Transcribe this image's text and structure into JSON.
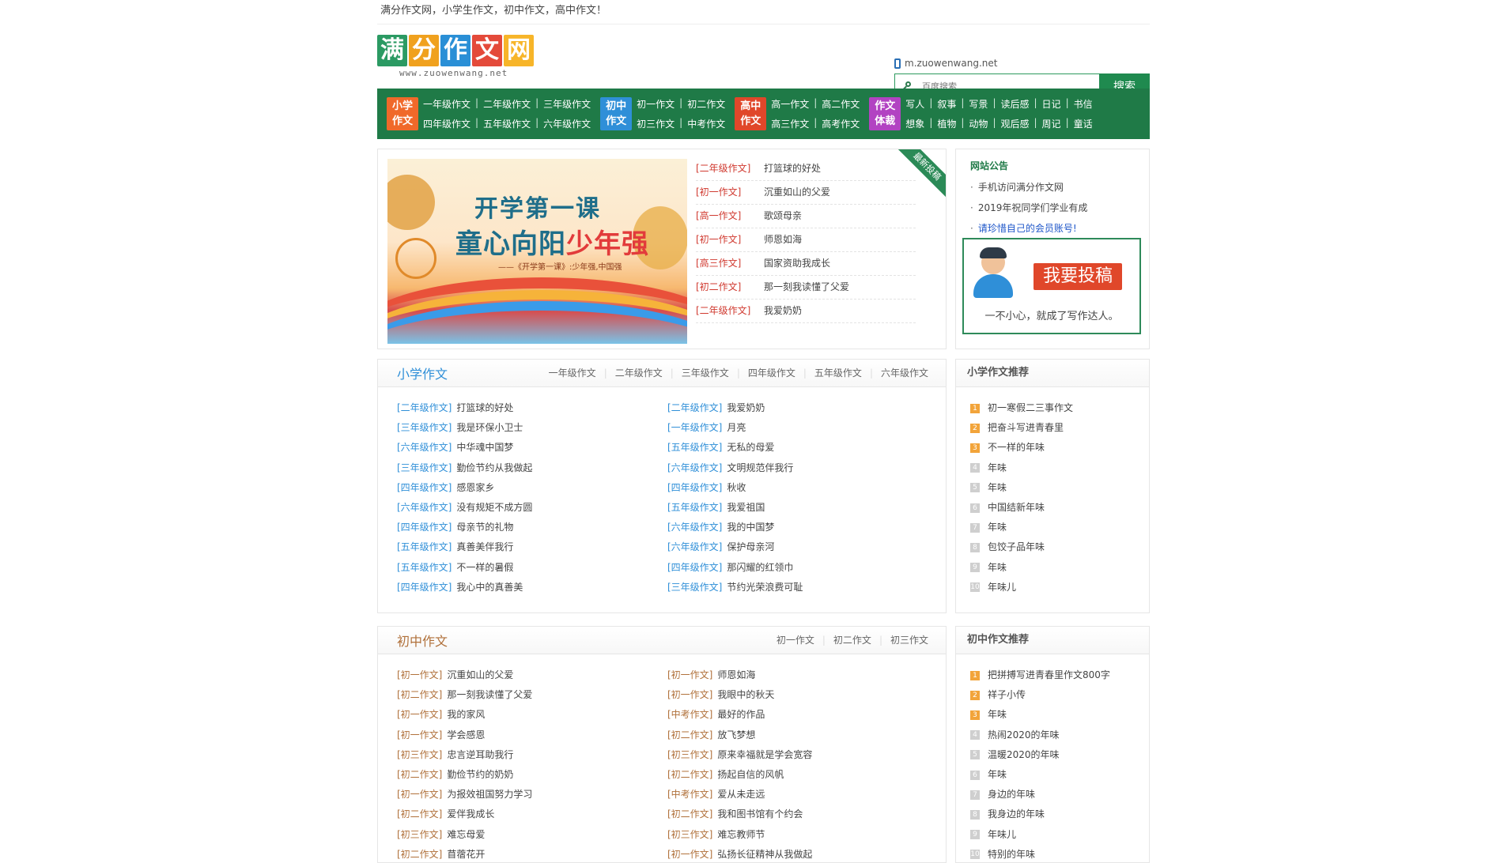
{
  "top_strip": "满分作文网，小学生作文，初中作文，高中作文！",
  "logo": {
    "chars": [
      "满",
      "分",
      "作",
      "文",
      "网"
    ],
    "colors": [
      "#2b9a63",
      "#f0a11e",
      "#2a8fd6",
      "#e44a3a",
      "#f7b529"
    ],
    "url": "www.zuowenwang.net"
  },
  "mobile_url": "m.zuowenwang.net",
  "search": {
    "placeholder": "百度搜索",
    "button": "搜索"
  },
  "nav": [
    {
      "badge": "小学\n作文",
      "color": "#f0692a",
      "rows": [
        [
          "一年级作文",
          "二年级作文",
          "三年级作文"
        ],
        [
          "四年级作文",
          "五年级作文",
          "六年级作文"
        ]
      ]
    },
    {
      "badge": "初中\n作文",
      "color": "#2f8fd8",
      "rows": [
        [
          "初一作文",
          "初二作文"
        ],
        [
          "初三作文",
          "中考作文"
        ]
      ]
    },
    {
      "badge": "高中\n作文",
      "color": "#e0472a",
      "rows": [
        [
          "高一作文",
          "高二作文"
        ],
        [
          "高三作文",
          "高考作文"
        ]
      ]
    },
    {
      "badge": "作文\n体裁",
      "color": "#b243c2",
      "rows": [
        [
          "写人",
          "叙事",
          "写景",
          "读后感",
          "日记",
          "书信"
        ],
        [
          "想象",
          "植物",
          "动物",
          "观后感",
          "周记",
          "童话"
        ]
      ]
    }
  ],
  "banner": {
    "line1": "开学第一课",
    "line2a": "童心向阳",
    "line2b": "少年强",
    "caption": "——《开学第一课》:少年强,中国强"
  },
  "ribbon": "最新投稿",
  "latest": [
    {
      "cat": "[二年级作文]",
      "title": "打篮球的好处"
    },
    {
      "cat": "[初一作文]",
      "title": "沉重如山的父爱"
    },
    {
      "cat": "[高一作文]",
      "title": "歌颂母亲"
    },
    {
      "cat": "[初一作文]",
      "title": "师恩如海"
    },
    {
      "cat": "[高三作文]",
      "title": "国家资助我成长"
    },
    {
      "cat": "[初二作文]",
      "title": "那一刻我读懂了父爱"
    },
    {
      "cat": "[二年级作文]",
      "title": "我爱奶奶"
    }
  ],
  "notice": {
    "title": "网站公告",
    "items": [
      "手机访问满分作文网",
      "2019年祝同学们学业有成",
      "请珍惜自己的会员账号!"
    ],
    "tougao_button": "我要投稿",
    "tougao_tip": "一不小心，就成了写作达人。"
  },
  "primary": {
    "title": "小学作文",
    "title_color": "#2f8fd8",
    "cat_color": "#2f8fd8",
    "tabs": [
      "一年级作文",
      "二年级作文",
      "三年级作文",
      "四年级作文",
      "五年级作文",
      "六年级作文"
    ],
    "left": [
      {
        "cat": "[二年级作文]",
        "title": "打篮球的好处"
      },
      {
        "cat": "[三年级作文]",
        "title": "我是环保小卫士"
      },
      {
        "cat": "[六年级作文]",
        "title": "中华魂中国梦"
      },
      {
        "cat": "[三年级作文]",
        "title": "勤俭节约从我做起"
      },
      {
        "cat": "[四年级作文]",
        "title": "感恩家乡"
      },
      {
        "cat": "[六年级作文]",
        "title": "没有规矩不成方圆"
      },
      {
        "cat": "[四年级作文]",
        "title": "母亲节的礼物"
      },
      {
        "cat": "[五年级作文]",
        "title": "真善美伴我行"
      },
      {
        "cat": "[五年级作文]",
        "title": "不一样的暑假"
      },
      {
        "cat": "[四年级作文]",
        "title": "我心中的真善美"
      }
    ],
    "right": [
      {
        "cat": "[二年级作文]",
        "title": "我爱奶奶"
      },
      {
        "cat": "[一年级作文]",
        "title": "月亮"
      },
      {
        "cat": "[五年级作文]",
        "title": "无私的母爱"
      },
      {
        "cat": "[六年级作文]",
        "title": "文明规范伴我行"
      },
      {
        "cat": "[四年级作文]",
        "title": "秋收"
      },
      {
        "cat": "[五年级作文]",
        "title": "我爱祖国"
      },
      {
        "cat": "[六年级作文]",
        "title": "我的中国梦"
      },
      {
        "cat": "[六年级作文]",
        "title": "保护母亲河"
      },
      {
        "cat": "[四年级作文]",
        "title": "那闪耀的红领巾"
      },
      {
        "cat": "[三年级作文]",
        "title": "节约光荣浪费可耻"
      }
    ],
    "side_title": "小学作文推荐",
    "side": [
      "初一寒假二三事作文",
      "把奋斗写进青春里",
      "不一样的年味",
      "年味",
      "年味",
      "中国结新年味",
      "年味",
      "包饺子品年味",
      "年味",
      "年味儿"
    ]
  },
  "middle": {
    "title": "初中作文",
    "title_color": "#b0703a",
    "cat_color": "#b0703a",
    "tabs": [
      "初一作文",
      "初二作文",
      "初三作文"
    ],
    "left": [
      {
        "cat": "[初一作文]",
        "title": "沉重如山的父爱"
      },
      {
        "cat": "[初二作文]",
        "title": "那一刻我读懂了父爱"
      },
      {
        "cat": "[初一作文]",
        "title": "我的家风"
      },
      {
        "cat": "[初一作文]",
        "title": "学会感恩"
      },
      {
        "cat": "[初三作文]",
        "title": "忠言逆耳助我行"
      },
      {
        "cat": "[初二作文]",
        "title": "勤俭节约的奶奶"
      },
      {
        "cat": "[初一作文]",
        "title": "为报效祖国努力学习"
      },
      {
        "cat": "[初二作文]",
        "title": "爱伴我成长"
      },
      {
        "cat": "[初三作文]",
        "title": "难忘母爱"
      },
      {
        "cat": "[初二作文]",
        "title": "苜蓿花开"
      }
    ],
    "right": [
      {
        "cat": "[初一作文]",
        "title": "师恩如海"
      },
      {
        "cat": "[初一作文]",
        "title": "我眼中的秋天"
      },
      {
        "cat": "[中考作文]",
        "title": "最好的作品"
      },
      {
        "cat": "[初二作文]",
        "title": "放飞梦想"
      },
      {
        "cat": "[初三作文]",
        "title": "原来幸福就是学会宽容"
      },
      {
        "cat": "[初二作文]",
        "title": "扬起自信的风帆"
      },
      {
        "cat": "[中考作文]",
        "title": "爱从未走远"
      },
      {
        "cat": "[初二作文]",
        "title": "我和图书馆有个约会"
      },
      {
        "cat": "[初三作文]",
        "title": "难忘教师节"
      },
      {
        "cat": "[初一作文]",
        "title": "弘扬长征精神从我做起"
      }
    ],
    "side_title": "初中作文推荐",
    "side": [
      "把拼搏写进青春里作文800字",
      "祥子小传",
      "年味",
      "热闹2020的年味",
      "温暖2020的年味",
      "年味",
      "身边的年味",
      "我身边的年味",
      "年味儿",
      "特别的年味"
    ]
  }
}
